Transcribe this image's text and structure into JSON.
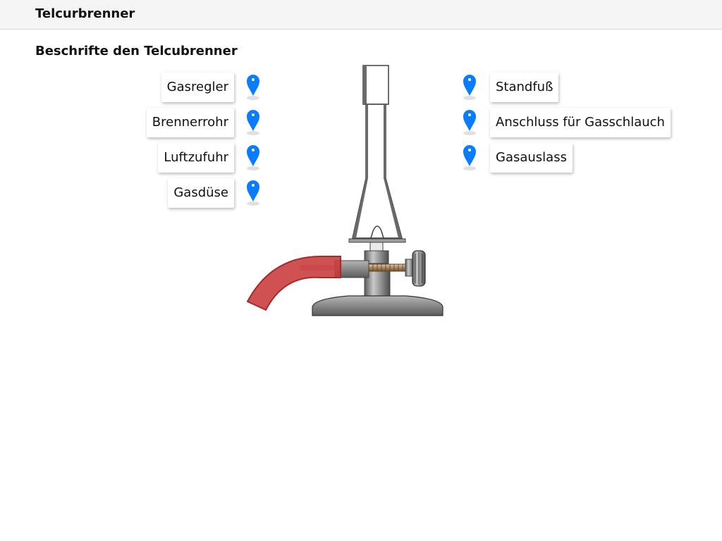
{
  "header": {
    "title": "Telcurbrenner"
  },
  "task": {
    "title": "Beschrifte den Telcubrenner"
  },
  "labels_left": [
    "Gasregler",
    "Brennerrohr",
    "Luftzufuhr",
    "Gasdüse"
  ],
  "labels_right": [
    "Standfuß",
    "Anschluss für Gasschlauch",
    "Gasauslass"
  ],
  "icons": {
    "marker": "map-marker-icon"
  },
  "colors": {
    "marker": "#0a7cff",
    "hose": "#c8393a",
    "metal": "#8a8a8a"
  }
}
